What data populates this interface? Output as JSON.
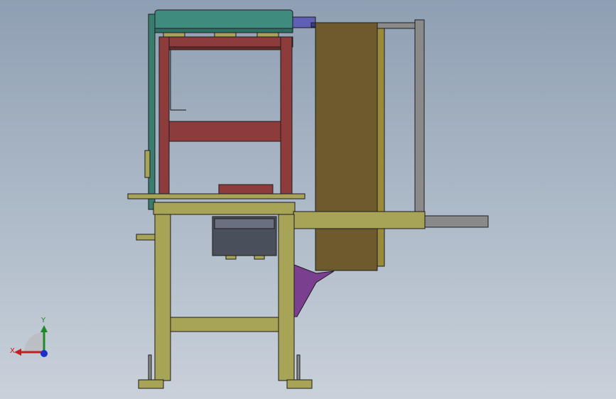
{
  "viewport": {
    "background_top": "#8f9fb3",
    "background_bottom": "#c9d1da"
  },
  "triad": {
    "x_label": "X",
    "y_label": "Y",
    "x_color": "#c0201e",
    "y_color": "#1d8a2a",
    "z_color": "#1a2fc9"
  },
  "parts": {
    "top_plate_color": "#3f8b7e",
    "frame_color": "#8e3b3b",
    "table_color": "#a7a357",
    "panel_color": "#6e5a2c",
    "rail_color": "#8a8a8a",
    "bracket_color": "#7a3f8e",
    "motor_color": "#4a4f5c",
    "cylinder_color": "#5f5fb5"
  }
}
